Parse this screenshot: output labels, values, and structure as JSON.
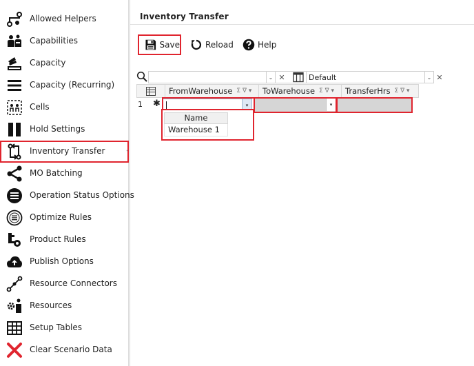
{
  "sidebar": {
    "items": [
      {
        "label": "Allowed Helpers",
        "icon": "allowed-helpers-icon"
      },
      {
        "label": "Capabilities",
        "icon": "capabilities-icon"
      },
      {
        "label": "Capacity",
        "icon": "capacity-icon"
      },
      {
        "label": "Capacity (Recurring)",
        "icon": "capacity-recurring-icon"
      },
      {
        "label": "Cells",
        "icon": "cells-icon"
      },
      {
        "label": "Hold Settings",
        "icon": "hold-settings-icon"
      },
      {
        "label": "Inventory Transfer",
        "icon": "inventory-transfer-icon",
        "active": true
      },
      {
        "label": "MO Batching",
        "icon": "mo-batching-icon"
      },
      {
        "label": "Operation Status Options",
        "icon": "operation-status-icon"
      },
      {
        "label": "Optimize Rules",
        "icon": "optimize-rules-icon"
      },
      {
        "label": "Product Rules",
        "icon": "product-rules-icon"
      },
      {
        "label": "Publish Options",
        "icon": "publish-options-icon"
      },
      {
        "label": "Resource Connectors",
        "icon": "resource-connectors-icon"
      },
      {
        "label": "Resources",
        "icon": "resources-icon"
      },
      {
        "label": "Setup Tables",
        "icon": "setup-tables-icon"
      },
      {
        "label": "Clear Scenario Data",
        "icon": "clear-scenario-icon"
      }
    ]
  },
  "main": {
    "title": "Inventory Transfer",
    "toolbar": {
      "save_label": "Save",
      "reload_label": "Reload",
      "help_label": "Help"
    },
    "filter": {
      "search_value": "",
      "layout_value": "Default"
    },
    "grid": {
      "columns": [
        "FromWarehouse",
        "ToWarehouse",
        "TransferHrs"
      ],
      "column_icons": "Σ ∇ ▾",
      "new_row_number": "1",
      "new_row_indicator": "✱"
    },
    "dropdown": {
      "header": "Name",
      "options": [
        "Warehouse 1"
      ]
    }
  },
  "colors": {
    "highlight": "#e0242e",
    "header_bg": "#f3f3f3",
    "row_bg": "#d6d6d6"
  }
}
